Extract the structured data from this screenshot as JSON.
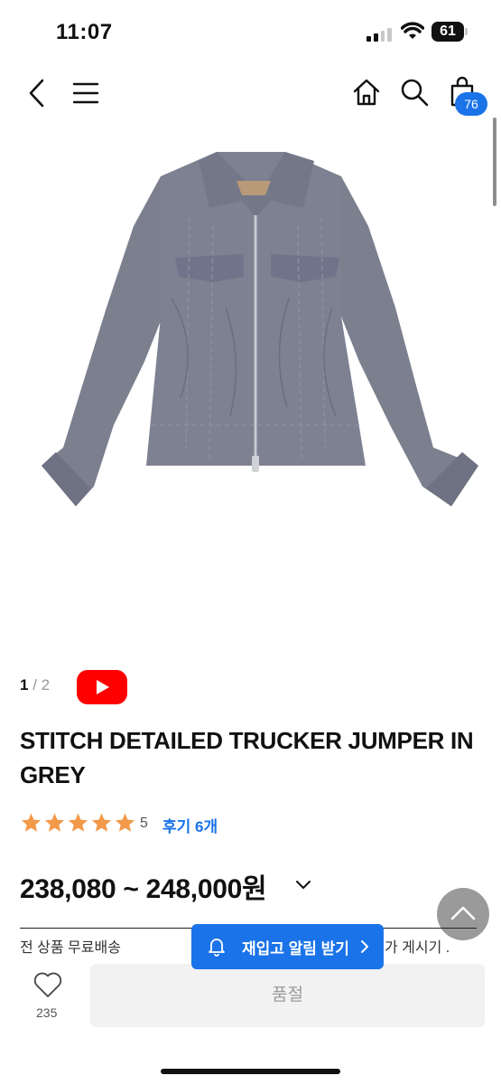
{
  "status_bar": {
    "time": "11:07",
    "battery": "61"
  },
  "nav": {
    "cart_count": "76"
  },
  "gallery": {
    "current": "1",
    "separator": " / ",
    "total": "2"
  },
  "product": {
    "title": "STITCH DETAILED TRUCKER JUMPER IN GREY",
    "rating": "5",
    "review_link": "후기 6개",
    "price": "238,080 ~ 248,000원"
  },
  "info": {
    "partial_left": "전 상품 무료배송",
    "partial_right": "가 게시기 ."
  },
  "restock": {
    "label": "재입고 알림 받기"
  },
  "bottom": {
    "wish_count": "235",
    "soldout_label": "품절"
  },
  "colors": {
    "accent": "#1a73e8",
    "youtube": "#ff0000",
    "star": "#f2994a",
    "jacket": "#7b7f8e"
  },
  "icons": [
    "back-icon",
    "menu-icon",
    "home-icon",
    "search-icon",
    "cart-icon",
    "youtube-play-icon",
    "star-icon",
    "chevron-down-icon",
    "arrow-up-icon",
    "bell-icon",
    "chevron-right-icon",
    "heart-icon"
  ]
}
